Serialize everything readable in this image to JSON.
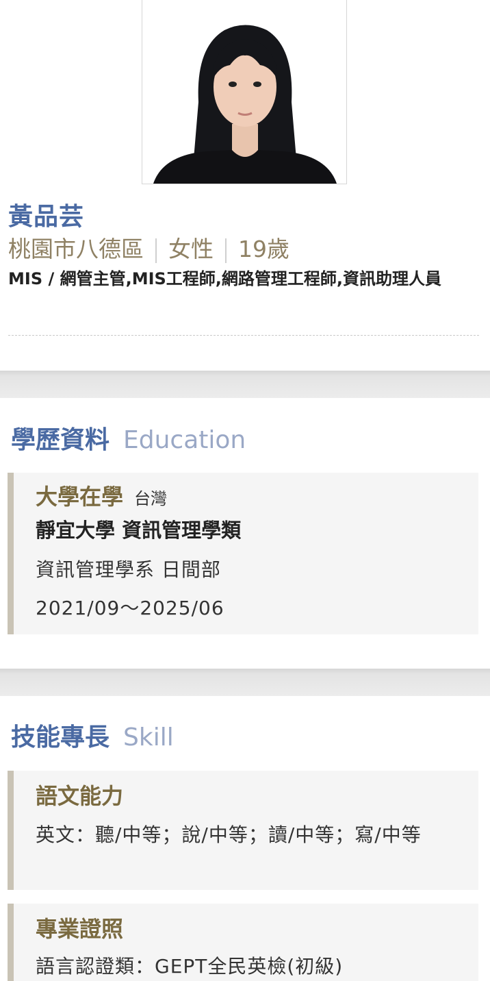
{
  "profile": {
    "photo_alt": "profile-photo",
    "name": "黃品芸",
    "location": "桃園市八德區",
    "gender": "女性",
    "age": "19歲",
    "desired_jobs": "MIS / 網管主管,MIS工程師,網路管理工程師,資訊助理人員"
  },
  "education": {
    "title": "學歷資料",
    "title_en": "Education",
    "entries": [
      {
        "status": "大學在學",
        "region": "台灣",
        "school_major": "靜宜大學 資訊管理學類",
        "department": "資訊管理學系 日間部",
        "period": "2021/09～2025/06"
      }
    ]
  },
  "skills": {
    "title": "技能專長",
    "title_en": "Skill",
    "cards": [
      {
        "heading": "語文能力",
        "text": "英文：聽/中等；說/中等；讀/中等；寫/中等"
      },
      {
        "heading": "專業證照",
        "text": "語言認證類：GEPT全民英檢(初級)"
      }
    ]
  },
  "colors": {
    "accent_blue": "#4a6aa3",
    "accent_gold": "#7a6a40",
    "card_bar": "#c9c3b5"
  }
}
